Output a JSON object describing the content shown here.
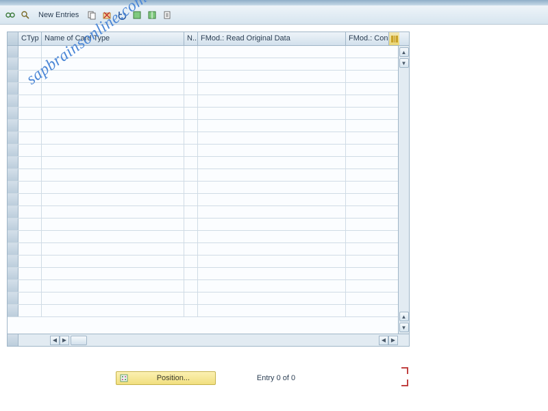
{
  "toolbar": {
    "new_entries_label": "New Entries"
  },
  "grid": {
    "columns": {
      "ctyp": "CTyp",
      "name": "Name of Card Type",
      "n": "N..",
      "fmod1": "FMod.: Read Original Data",
      "fmod2": "FMod.: Con"
    }
  },
  "footer": {
    "position_label": "Position...",
    "entry_text": "Entry 0 of 0"
  },
  "watermark": "sapbrainsonline.com"
}
